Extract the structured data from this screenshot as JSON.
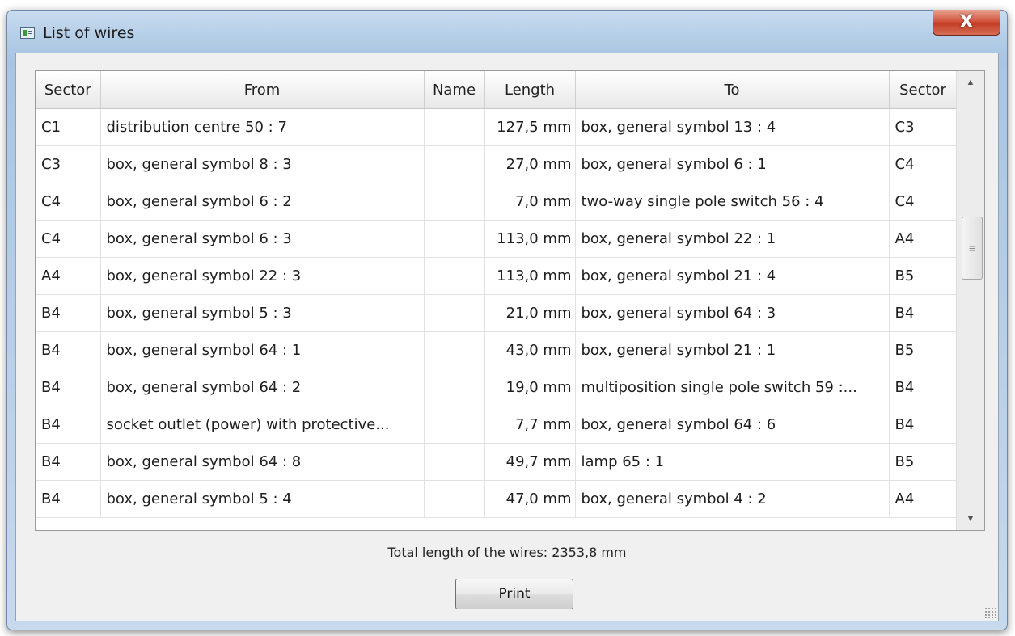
{
  "window": {
    "title": "List of wires",
    "close_label": "X"
  },
  "table": {
    "columns": [
      "Sector",
      "From",
      "Name",
      "Length",
      "To",
      "Sector"
    ],
    "rows": [
      {
        "sector_from": "C1",
        "from": "distribution centre 50 : 7",
        "name": "",
        "length": "127,5 mm",
        "to": "box, general symbol 13 : 4",
        "sector_to": "C3"
      },
      {
        "sector_from": "C3",
        "from": "box, general symbol 8 : 3",
        "name": "",
        "length": "27,0 mm",
        "to": "box, general symbol 6 : 1",
        "sector_to": "C4"
      },
      {
        "sector_from": "C4",
        "from": "box, general symbol 6 : 2",
        "name": "",
        "length": "7,0 mm",
        "to": "two-way single pole switch 56 : 4",
        "sector_to": "C4"
      },
      {
        "sector_from": "C4",
        "from": "box, general symbol 6 : 3",
        "name": "",
        "length": "113,0 mm",
        "to": "box, general symbol 22 : 1",
        "sector_to": "A4"
      },
      {
        "sector_from": "A4",
        "from": "box, general symbol 22 : 3",
        "name": "",
        "length": "113,0 mm",
        "to": "box, general symbol 21 : 4",
        "sector_to": "B5"
      },
      {
        "sector_from": "B4",
        "from": "box, general symbol 5 : 3",
        "name": "",
        "length": "21,0 mm",
        "to": "box, general symbol 64 : 3",
        "sector_to": "B4"
      },
      {
        "sector_from": "B4",
        "from": "box, general symbol 64 : 1",
        "name": "",
        "length": "43,0 mm",
        "to": "box, general symbol 21 : 1",
        "sector_to": "B5"
      },
      {
        "sector_from": "B4",
        "from": "box, general symbol 64 : 2",
        "name": "",
        "length": "19,0 mm",
        "to": "multiposition single pole switch 59 :...",
        "sector_to": "B4"
      },
      {
        "sector_from": "B4",
        "from": "socket outlet (power) with protective...",
        "name": "",
        "length": "7,7 mm",
        "to": "box, general symbol 64 : 6",
        "sector_to": "B4"
      },
      {
        "sector_from": "B4",
        "from": "box, general symbol 64 : 8",
        "name": "",
        "length": "49,7 mm",
        "to": "lamp 65 : 1",
        "sector_to": "B5"
      },
      {
        "sector_from": "B4",
        "from": "box, general symbol 5 : 4",
        "name": "",
        "length": "47,0 mm",
        "to": "box, general symbol 4 : 2",
        "sector_to": "A4"
      }
    ]
  },
  "total_label": "Total length of the wires: 2353,8 mm",
  "print_label": "Print",
  "icons": {
    "app": "list-window-icon",
    "scroll_up": "arrow-up-icon",
    "scroll_down": "arrow-down-icon",
    "thumb": "grip-lines-icon",
    "resize": "resize-grip-icon"
  }
}
